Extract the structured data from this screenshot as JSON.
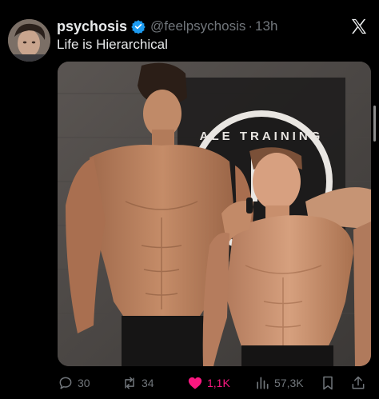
{
  "tweet": {
    "display_name": "psychosis",
    "handle": "@feelpsychosis",
    "separator": "·",
    "time": "13h",
    "text": "Life is Hierarchical",
    "verified": true,
    "sign_text": "ALE TRAINING"
  },
  "actions": {
    "replies": "30",
    "reposts": "34",
    "likes": "1,1K",
    "views": "57,3K"
  },
  "colors": {
    "background": "#000000",
    "text": "#e7e9ea",
    "muted": "#71767b",
    "verified_blue": "#1d9bf0",
    "like_pink": "#f91880"
  }
}
